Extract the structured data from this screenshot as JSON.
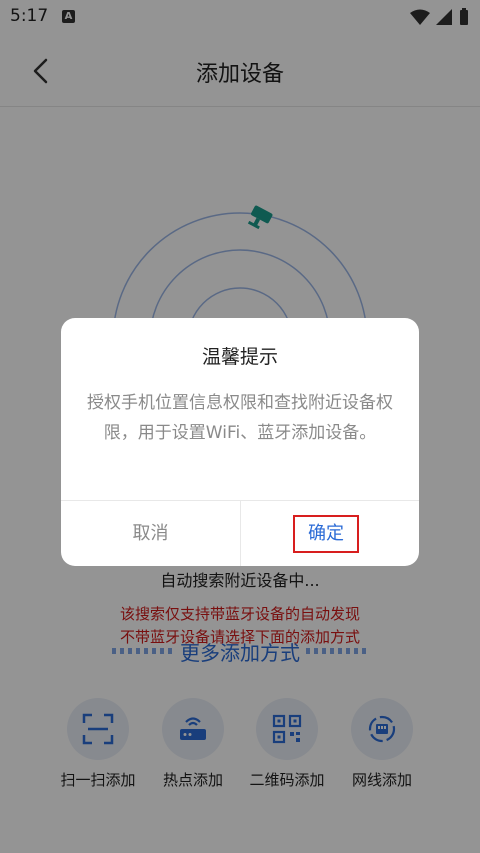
{
  "status_bar": {
    "time": "5:17",
    "notification_badge": "A"
  },
  "header": {
    "title": "添加设备"
  },
  "main": {
    "auto_search_text": "自动搜索附近设备中...",
    "warning_line1": "该搜索仅支持带蓝牙设备的自动发现",
    "warning_line2": "不带蓝牙设备请选择下面的添加方式",
    "more_methods_label": "更多添加方式",
    "methods": [
      {
        "label": "扫一扫添加",
        "icon": "scan-icon"
      },
      {
        "label": "热点添加",
        "icon": "router-icon"
      },
      {
        "label": "二维码添加",
        "icon": "qrcode-icon"
      },
      {
        "label": "网线添加",
        "icon": "ethernet-icon"
      }
    ]
  },
  "dialog": {
    "title": "温馨提示",
    "message": "授权手机位置信息权限和查找附近设备权限，用于设置WiFi、蓝牙添加设备。",
    "cancel_label": "取消",
    "confirm_label": "确定"
  },
  "colors": {
    "accent": "#2b6bd6",
    "warning": "#d11a1a",
    "highlight_border": "#d81e1e",
    "camera_icon": "#1a9c8c"
  }
}
